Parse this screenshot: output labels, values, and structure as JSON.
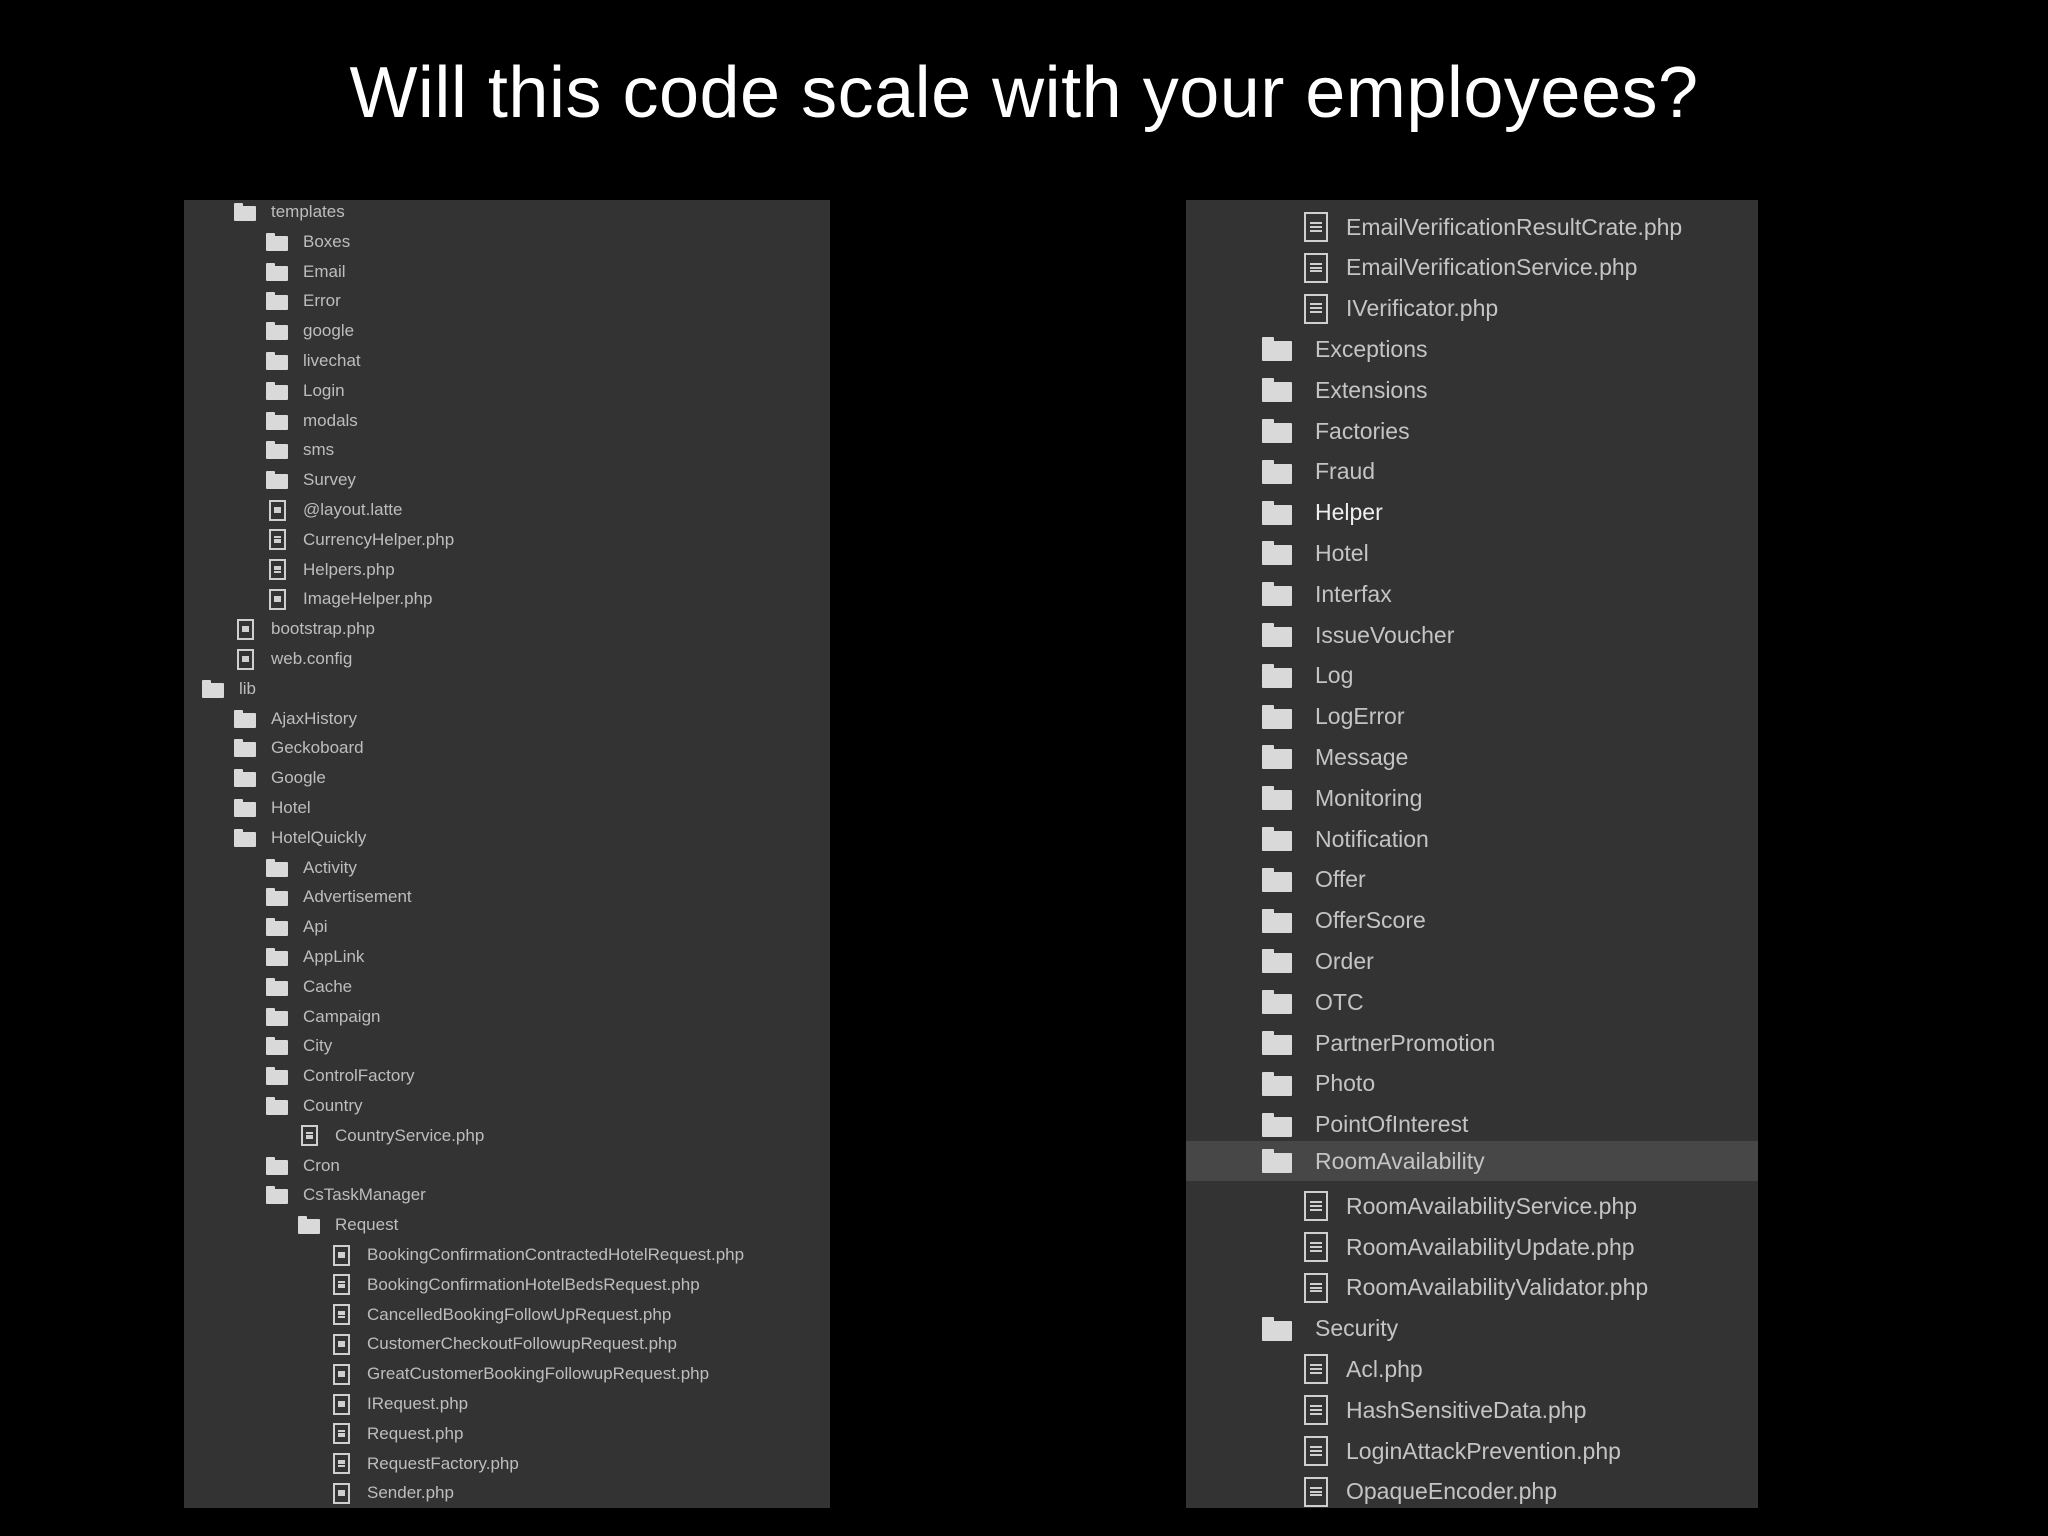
{
  "title": "Will this code scale with your employees?",
  "left_tree": [
    {
      "label": "templates",
      "kind": "folder",
      "level": 1
    },
    {
      "label": "Boxes",
      "kind": "folder",
      "level": 2
    },
    {
      "label": "Email",
      "kind": "folder",
      "level": 2
    },
    {
      "label": "Error",
      "kind": "folder",
      "level": 2
    },
    {
      "label": "google",
      "kind": "folder",
      "level": 2
    },
    {
      "label": "livechat",
      "kind": "folder",
      "level": 2
    },
    {
      "label": "Login",
      "kind": "folder",
      "level": 2
    },
    {
      "label": "modals",
      "kind": "folder",
      "level": 2
    },
    {
      "label": "sms",
      "kind": "folder",
      "level": 2
    },
    {
      "label": "Survey",
      "kind": "folder",
      "level": 2
    },
    {
      "label": "@layout.latte",
      "kind": "file",
      "level": 2
    },
    {
      "label": "CurrencyHelper.php",
      "kind": "file",
      "level": 2
    },
    {
      "label": "Helpers.php",
      "kind": "file",
      "level": 2
    },
    {
      "label": "ImageHelper.php",
      "kind": "file",
      "level": 2
    },
    {
      "label": "bootstrap.php",
      "kind": "file",
      "level": 1
    },
    {
      "label": "web.config",
      "kind": "file",
      "level": 1
    },
    {
      "label": "lib",
      "kind": "folder",
      "level": 0
    },
    {
      "label": "AjaxHistory",
      "kind": "folder",
      "level": 1
    },
    {
      "label": "Geckoboard",
      "kind": "folder",
      "level": 1
    },
    {
      "label": "Google",
      "kind": "folder",
      "level": 1
    },
    {
      "label": "Hotel",
      "kind": "folder",
      "level": 1
    },
    {
      "label": "HotelQuickly",
      "kind": "folder",
      "level": 1
    },
    {
      "label": "Activity",
      "kind": "folder",
      "level": 2
    },
    {
      "label": "Advertisement",
      "kind": "folder",
      "level": 2
    },
    {
      "label": "Api",
      "kind": "folder",
      "level": 2
    },
    {
      "label": "AppLink",
      "kind": "folder",
      "level": 2
    },
    {
      "label": "Cache",
      "kind": "folder",
      "level": 2
    },
    {
      "label": "Campaign",
      "kind": "folder",
      "level": 2
    },
    {
      "label": "City",
      "kind": "folder",
      "level": 2
    },
    {
      "label": "ControlFactory",
      "kind": "folder",
      "level": 2
    },
    {
      "label": "Country",
      "kind": "folder",
      "level": 2
    },
    {
      "label": "CountryService.php",
      "kind": "file",
      "level": 3
    },
    {
      "label": "Cron",
      "kind": "folder",
      "level": 2
    },
    {
      "label": "CsTaskManager",
      "kind": "folder",
      "level": 2
    },
    {
      "label": "Request",
      "kind": "folder",
      "level": 3
    },
    {
      "label": "BookingConfirmationContractedHotelRequest.php",
      "kind": "file",
      "level": 4
    },
    {
      "label": "BookingConfirmationHotelBedsRequest.php",
      "kind": "file",
      "level": 4
    },
    {
      "label": "CancelledBookingFollowUpRequest.php",
      "kind": "file",
      "level": 4
    },
    {
      "label": "CustomerCheckoutFollowupRequest.php",
      "kind": "file",
      "level": 4
    },
    {
      "label": "GreatCustomerBookingFollowupRequest.php",
      "kind": "file",
      "level": 4
    },
    {
      "label": "IRequest.php",
      "kind": "file",
      "level": 4
    },
    {
      "label": "Request.php",
      "kind": "file",
      "level": 4
    },
    {
      "label": "RequestFactory.php",
      "kind": "file",
      "level": 4
    },
    {
      "label": "Sender.php",
      "kind": "file",
      "level": 4
    }
  ],
  "right_tree": [
    {
      "label": "EmailVerificationResultCrate.php",
      "kind": "file",
      "level": 1
    },
    {
      "label": "EmailVerificationService.php",
      "kind": "file",
      "level": 1
    },
    {
      "label": "IVerificator.php",
      "kind": "file",
      "level": 1
    },
    {
      "label": "Exceptions",
      "kind": "folder",
      "level": 0
    },
    {
      "label": "Extensions",
      "kind": "folder",
      "level": 0
    },
    {
      "label": "Factories",
      "kind": "folder",
      "level": 0
    },
    {
      "label": "Fraud",
      "kind": "folder",
      "level": 0
    },
    {
      "label": "Helper",
      "kind": "folder",
      "level": 0,
      "emphasized": true
    },
    {
      "label": "Hotel",
      "kind": "folder",
      "level": 0
    },
    {
      "label": "Interfax",
      "kind": "folder",
      "level": 0
    },
    {
      "label": "IssueVoucher",
      "kind": "folder",
      "level": 0
    },
    {
      "label": "Log",
      "kind": "folder",
      "level": 0
    },
    {
      "label": "LogError",
      "kind": "folder",
      "level": 0
    },
    {
      "label": "Message",
      "kind": "folder",
      "level": 0
    },
    {
      "label": "Monitoring",
      "kind": "folder",
      "level": 0
    },
    {
      "label": "Notification",
      "kind": "folder",
      "level": 0
    },
    {
      "label": "Offer",
      "kind": "folder",
      "level": 0
    },
    {
      "label": "OfferScore",
      "kind": "folder",
      "level": 0
    },
    {
      "label": "Order",
      "kind": "folder",
      "level": 0
    },
    {
      "label": "OTC",
      "kind": "folder",
      "level": 0
    },
    {
      "label": "PartnerPromotion",
      "kind": "folder",
      "level": 0
    },
    {
      "label": "Photo",
      "kind": "folder",
      "level": 0
    },
    {
      "label": "PointOfInterest",
      "kind": "folder",
      "level": 0
    },
    {
      "label": "RoomAvailability",
      "kind": "folder",
      "level": 0,
      "selected": true
    },
    {
      "label": "RoomAvailabilityService.php",
      "kind": "file",
      "level": 1
    },
    {
      "label": "RoomAvailabilityUpdate.php",
      "kind": "file",
      "level": 1
    },
    {
      "label": "RoomAvailabilityValidator.php",
      "kind": "file",
      "level": 1
    },
    {
      "label": "Security",
      "kind": "folder",
      "level": 0
    },
    {
      "label": "Acl.php",
      "kind": "file",
      "level": 1
    },
    {
      "label": "HashSensitiveData.php",
      "kind": "file",
      "level": 1
    },
    {
      "label": "LoginAttackPrevention.php",
      "kind": "file",
      "level": 1
    },
    {
      "label": "OpaqueEncoder.php",
      "kind": "file",
      "level": 1
    }
  ]
}
